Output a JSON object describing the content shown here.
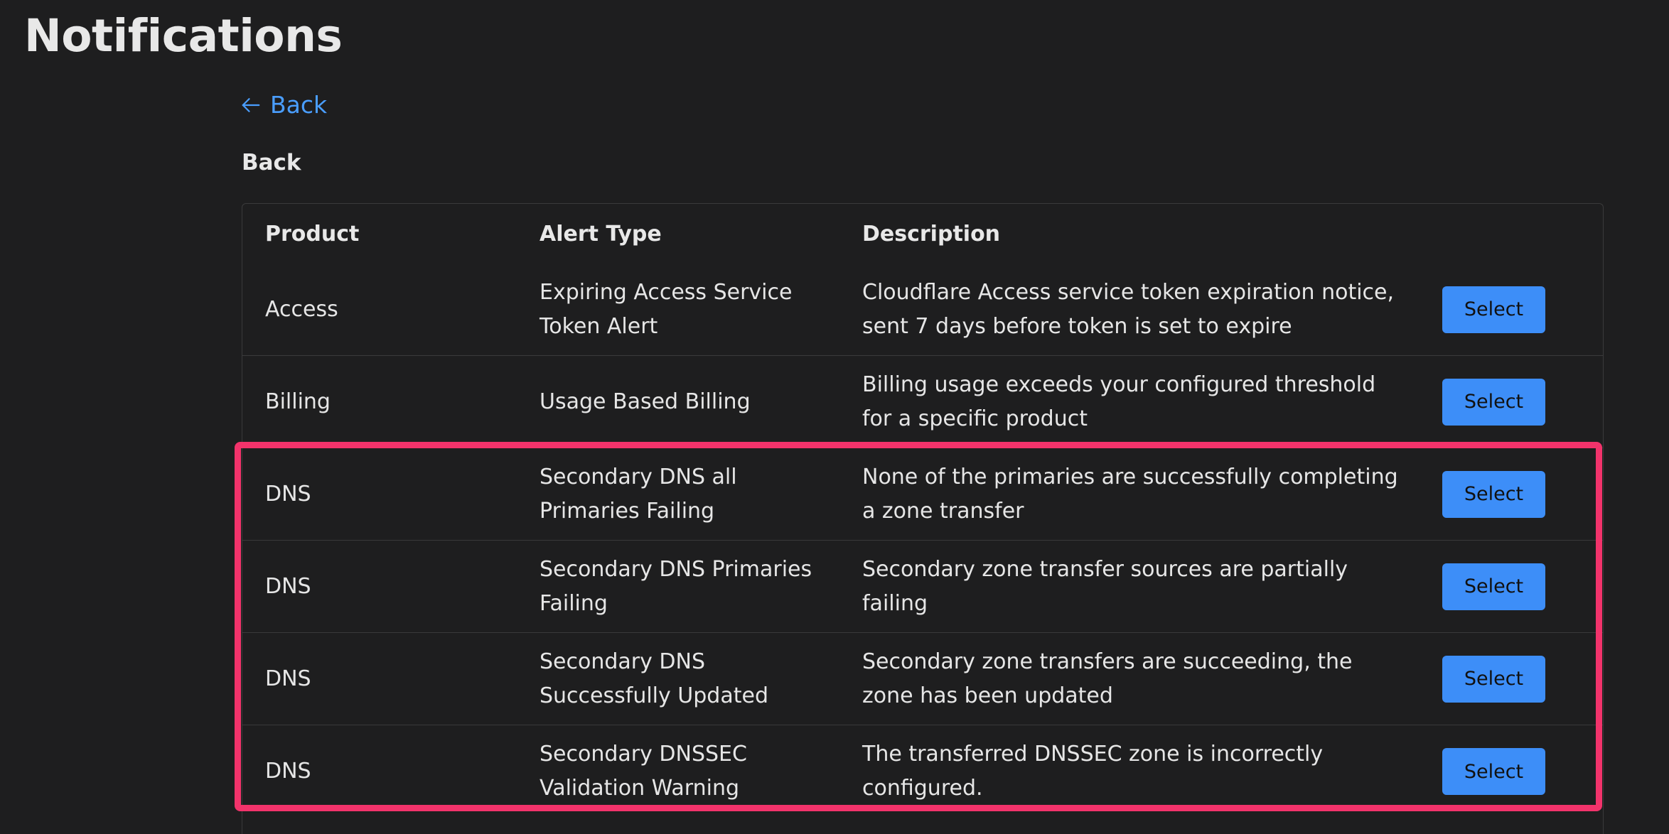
{
  "page": {
    "title": "Notifications",
    "back_link_label": "Back",
    "section_heading": "Back"
  },
  "table": {
    "columns": [
      "Product",
      "Alert Type",
      "Description"
    ],
    "select_label": "Select",
    "rows": [
      {
        "product": "Access",
        "alert_type": "Expiring Access Service Token Alert",
        "description": "Cloudflare Access service token expiration notice, sent 7 days before token is set to expire"
      },
      {
        "product": "Billing",
        "alert_type": "Usage Based Billing",
        "description": "Billing usage exceeds your configured threshold for a specific product"
      },
      {
        "product": "DNS",
        "alert_type": "Secondary DNS all Primaries Failing",
        "description": "None of the primaries are successfully completing a zone transfer"
      },
      {
        "product": "DNS",
        "alert_type": "Secondary DNS Primaries Failing",
        "description": "Secondary zone transfer sources are partially failing"
      },
      {
        "product": "DNS",
        "alert_type": "Secondary DNS Successfully Updated",
        "description": "Secondary zone transfers are succeeding, the zone has been updated"
      },
      {
        "product": "DNS",
        "alert_type": "Secondary DNSSEC Validation Warning",
        "description": "The transferred DNSSEC zone is incorrectly configured."
      }
    ]
  },
  "colors": {
    "background": "#1e1e1f",
    "link": "#4a9eff",
    "button": "#3d8ef8",
    "highlight": "#f2336b"
  },
  "icons": {
    "back": "arrow-left-icon"
  }
}
